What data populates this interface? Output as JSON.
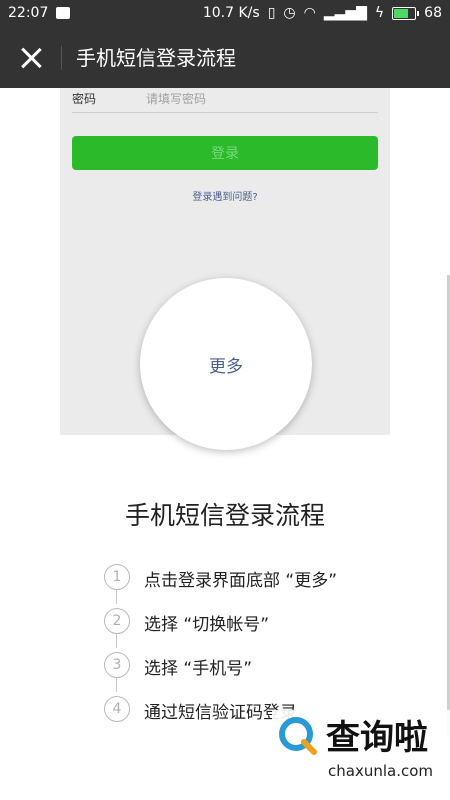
{
  "status_bar": {
    "time": "22:07",
    "network_speed": "10.7 K/s",
    "battery_level": "68"
  },
  "header": {
    "title": "手机短信登录流程",
    "close_icon": "close-icon"
  },
  "screenshot_preview": {
    "password_label": "密码",
    "password_placeholder": "请填写密码",
    "login_button_label": "登录",
    "problem_link": "登录遇到问题?",
    "more_circle_label": "更多"
  },
  "section": {
    "title": "手机短信登录流程",
    "steps": [
      {
        "num": "1",
        "text": "点击登录界面底部 “更多”"
      },
      {
        "num": "2",
        "text": "选择 “切换帐号”"
      },
      {
        "num": "3",
        "text": "选择 “手机号”"
      },
      {
        "num": "4",
        "text": "通过短信验证码登录"
      }
    ]
  },
  "watermark": {
    "brand": "查询啦",
    "url": "chaxunla.com"
  },
  "colors": {
    "bar_bg": "#333333",
    "green": "#2aba2a",
    "link_blue": "#4a5f8a"
  }
}
